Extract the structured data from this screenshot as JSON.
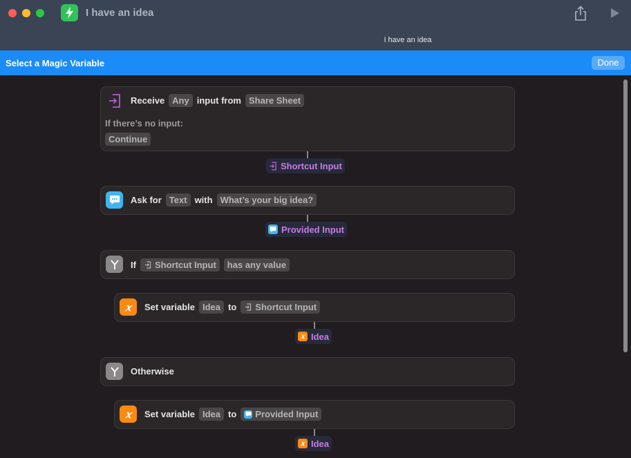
{
  "window": {
    "title": "I have an idea",
    "tab_title": "I have an idea"
  },
  "magic_bar": {
    "label": "Select a Magic Variable",
    "done": "Done"
  },
  "colors": {
    "accent_blue": "#1b8bf8",
    "variable_purple": "#c67de0",
    "titlebar": "#3a4455",
    "canvas": "#201c1f"
  },
  "receive": {
    "label": "Receive",
    "type_token": "Any",
    "from_text": "input from",
    "source_token": "Share Sheet",
    "no_input_label": "If there’s no input:",
    "no_input_action": "Continue",
    "icon": "receive-input-icon"
  },
  "shortcut_input_var": {
    "label": "Shortcut Input",
    "icon": "receive-input-icon"
  },
  "ask": {
    "label": "Ask for",
    "type_token": "Text",
    "with_text": "with",
    "prompt_token": "What’s your big idea?",
    "icon": "speech-bubble-icon"
  },
  "provided_input_var": {
    "label": "Provided Input",
    "icon": "speech-bubble-icon"
  },
  "if_block": {
    "label": "If",
    "condition_token": "Shortcut Input",
    "condition_text": "has any value",
    "icon": "branch-icon"
  },
  "set_var_1": {
    "label": "Set variable",
    "name_token": "Idea",
    "to_text": "to",
    "value_token": "Shortcut Input",
    "icon": "variable-x-icon"
  },
  "idea_var_1": {
    "label": "Idea",
    "icon": "variable-x-icon"
  },
  "otherwise": {
    "label": "Otherwise",
    "icon": "branch-icon"
  },
  "set_var_2": {
    "label": "Set variable",
    "name_token": "Idea",
    "to_text": "to",
    "value_token": "Provided Input",
    "icon": "variable-x-icon"
  },
  "idea_var_2": {
    "label": "Idea",
    "icon": "variable-x-icon"
  }
}
